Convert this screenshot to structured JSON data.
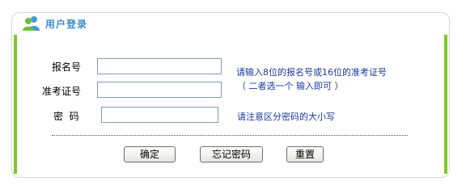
{
  "panel": {
    "title": "用户登录",
    "title_icon": "users-icon"
  },
  "form": {
    "registration_number": {
      "label": "报名号",
      "value": "",
      "placeholder": ""
    },
    "admission_ticket": {
      "label": "准考证号",
      "value": "",
      "placeholder": ""
    },
    "password": {
      "label": "密  码",
      "value": "",
      "placeholder": ""
    }
  },
  "hints": {
    "number_hint_line1": "请输入8位的报名号或16位的准考证号",
    "number_hint_line2": "（ 二者选一个  输入即可 ）",
    "password_hint": "请注意区分密码的大小写"
  },
  "buttons": {
    "confirm": "确定",
    "forgot_password": "忘记密码",
    "reset": "重置"
  },
  "colors": {
    "accent_green": "#7fc82a",
    "title_blue": "#3b8fd0",
    "hint_blue": "#1a3a9c"
  }
}
